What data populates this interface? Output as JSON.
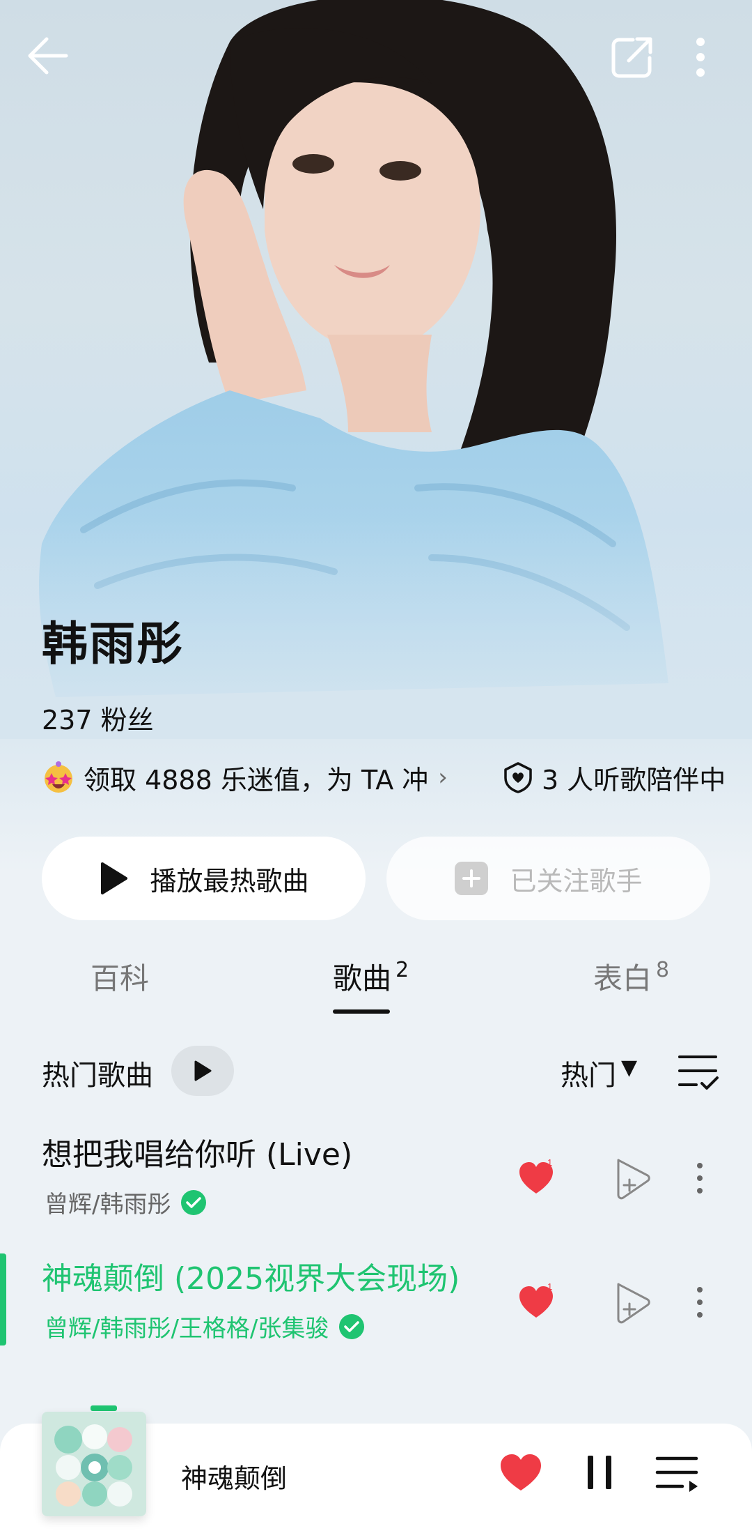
{
  "artist": {
    "name": "韩雨彤",
    "fans": "237 粉丝",
    "promo_text": "领取 4888 乐迷值，为 TA 冲",
    "companion_text": "3 人听歌陪伴中"
  },
  "actions": {
    "play_hot_label": "播放最热歌曲",
    "follow_label": "已关注歌手"
  },
  "tabs": [
    {
      "label": "百科",
      "count": ""
    },
    {
      "label": "歌曲",
      "count": "2"
    },
    {
      "label": "表白",
      "count": "8"
    }
  ],
  "section": {
    "title": "热门歌曲",
    "sort_label": "热门",
    "sort_caret": "▼"
  },
  "songs": [
    {
      "title": "想把我唱给你听 (Live)",
      "artists": "曾辉/韩雨彤",
      "like_count": "1",
      "playing": false
    },
    {
      "title": "神魂颠倒 (2025视界大会现场)",
      "artists": "曾辉/韩雨彤/王格格/张集骏",
      "like_count": "1",
      "playing": true
    }
  ],
  "player": {
    "title": "神魂颠倒"
  },
  "colors": {
    "accent_green": "#1fc471",
    "heart_red": "#ef3b45"
  },
  "icons": {
    "back": "arrow-left-icon",
    "share": "share-icon",
    "more": "more-vertical-icon",
    "play": "play-icon",
    "add": "plus-icon",
    "heart": "heart-icon",
    "pause": "pause-icon",
    "queue": "playlist-icon",
    "verified": "verified-check-icon",
    "shield": "shield-heart-icon",
    "list_manage": "list-check-icon",
    "add_to_playlist": "add-to-playlist-icon"
  }
}
